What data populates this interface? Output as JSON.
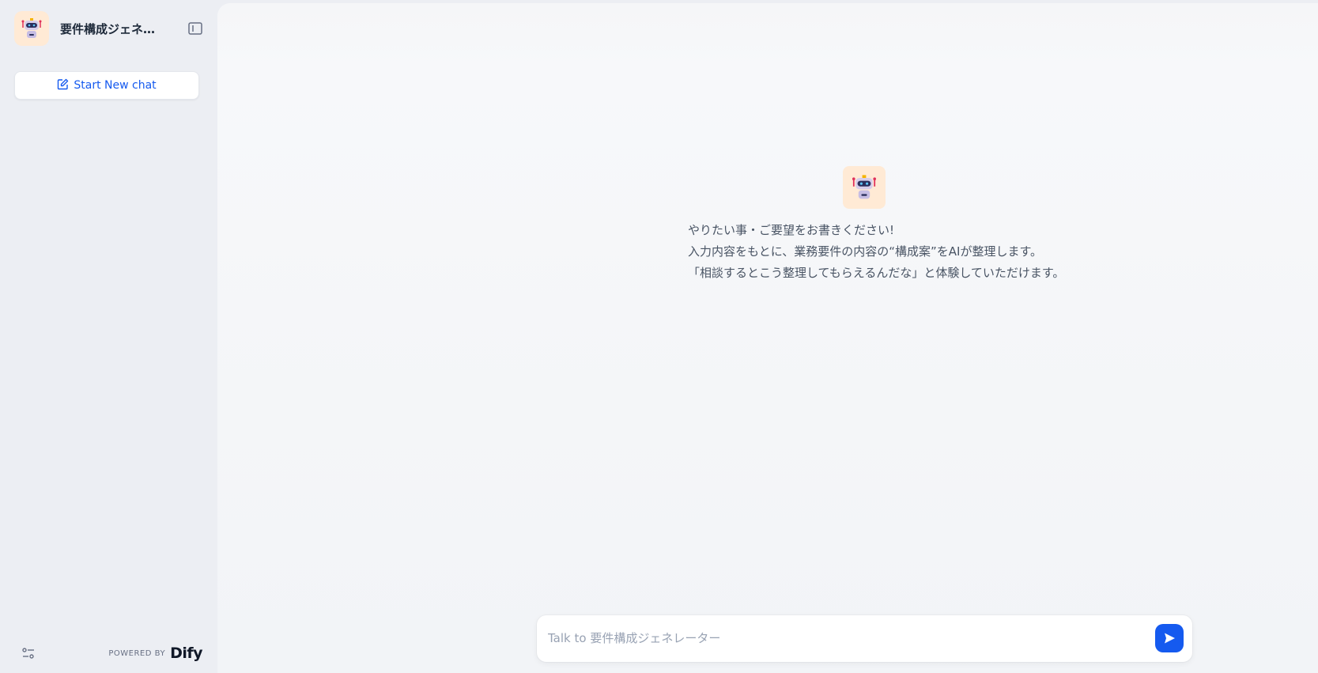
{
  "app": {
    "title": "要件構成ジェネレ...",
    "icon": "robot-icon"
  },
  "sidebar": {
    "collapse_icon": "sidebar-collapse-icon",
    "new_chat_label": "Start New chat",
    "new_chat_icon": "edit-icon",
    "settings_icon": "sliders-icon",
    "powered_by": "POWERED BY",
    "brand": "Dify"
  },
  "welcome": {
    "icon": "robot-icon",
    "lines": [
      "やりたい事・ご要望をお書きください!",
      "入力内容をもとに、業務要件の内容の“構成案”をAIが整理します。",
      "「相談するとこう整理してもらえるんだな」と体験していただけます。"
    ]
  },
  "chat_input": {
    "placeholder": "Talk to 要件構成ジェネレーター",
    "value": "",
    "send_icon": "send-icon"
  },
  "colors": {
    "accent": "#155aef",
    "icon_bg": "#ffead5",
    "sidebar_bg": "#eceef3"
  }
}
